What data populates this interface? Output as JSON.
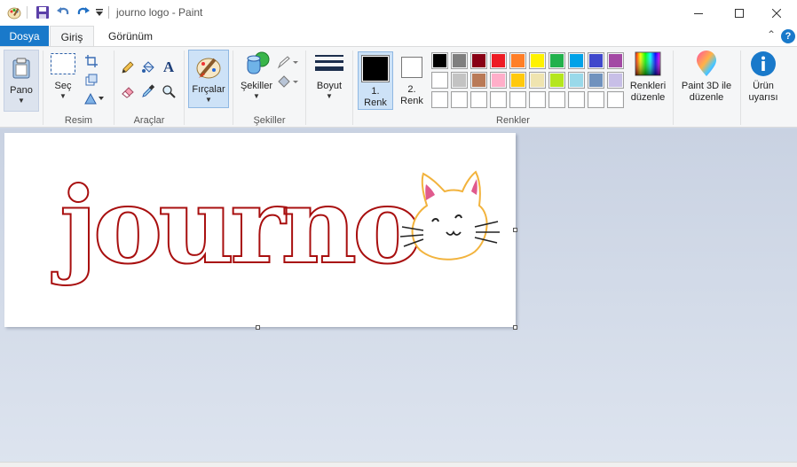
{
  "window": {
    "title": "journo logo - Paint",
    "minimize_icon": "minimize-icon",
    "maximize_icon": "maximize-icon",
    "close_icon": "close-icon"
  },
  "quick_access": [
    "paint-app-icon",
    "save-icon",
    "undo-icon",
    "redo-icon",
    "customize-dropdown-icon"
  ],
  "menu": {
    "file": "Dosya",
    "home": "Giriş",
    "view": "Görünüm"
  },
  "ribbon": {
    "clipboard": {
      "paste_label": "Pano"
    },
    "image": {
      "select_label": "Seç",
      "group_label": "Resim"
    },
    "tools": {
      "group_label": "Araçlar"
    },
    "brushes": {
      "label": "Fırçalar"
    },
    "shapes": {
      "label": "Şekiller",
      "group_label": "Şekiller"
    },
    "size": {
      "label": "Boyut"
    },
    "colors": {
      "color1_line1": "1.",
      "color1_line2": "Renk",
      "color2_line1": "2.",
      "color2_line2": "Renk",
      "edit_colors_line1": "Renkleri",
      "edit_colors_line2": "düzenle",
      "group_label": "Renkler",
      "color1_value": "#000000",
      "color2_value": "#ffffff",
      "palette_row1": [
        "#000000",
        "#7f7f7f",
        "#880015",
        "#ed1c24",
        "#ff7f27",
        "#fff200",
        "#22b14c",
        "#00a2e8",
        "#3f48cc",
        "#a349a4"
      ],
      "palette_row2": [
        "#ffffff",
        "#c3c3c3",
        "#b97a57",
        "#ffaec9",
        "#ffc90e",
        "#efe4b0",
        "#b5e61d",
        "#99d9ea",
        "#7092be",
        "#c8bfe7"
      ],
      "palette_row3": [
        "#ffffff",
        "#ffffff",
        "#ffffff",
        "#ffffff",
        "#ffffff",
        "#ffffff",
        "#ffffff",
        "#ffffff",
        "#ffffff",
        "#ffffff"
      ]
    },
    "paint3d": {
      "line1": "Paint 3D ile",
      "line2": "düzenle"
    },
    "product_alert": {
      "line1": "Ürün",
      "line2": "uyarısı"
    }
  },
  "canvas": {
    "logo_text": "journo",
    "logo_stroke_color": "#a80f0f",
    "cat_color": "#f2b33d"
  }
}
